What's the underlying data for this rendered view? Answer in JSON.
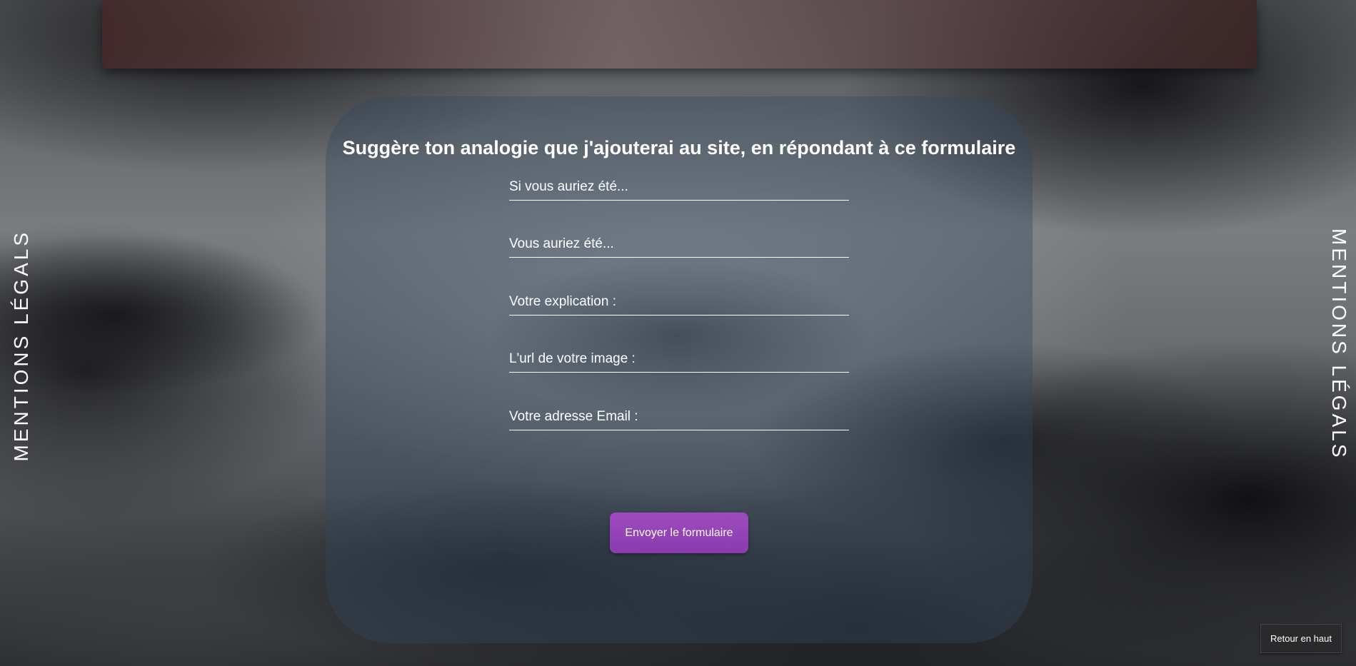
{
  "side_links": {
    "left_label": "MENTIONS LÉGALS",
    "right_label": "MENTIONS LÉGALS"
  },
  "form": {
    "title": "Suggère ton analogie que j'ajouterai au site, en répondant à ce formulaire",
    "fields": [
      {
        "placeholder": "Si vous auriez été...",
        "value": ""
      },
      {
        "placeholder": "Vous auriez été...",
        "value": ""
      },
      {
        "placeholder": "Votre explication :",
        "value": ""
      },
      {
        "placeholder": "L'url de votre image :",
        "value": ""
      },
      {
        "placeholder": "Votre adresse Email :",
        "value": ""
      }
    ],
    "submit_label": "Envoyer le formulaire"
  },
  "back_to_top_label": "Retour en haut",
  "colors": {
    "submit_button": "#9d4cbf",
    "card_background": "#32465f",
    "text": "#ffffff"
  }
}
